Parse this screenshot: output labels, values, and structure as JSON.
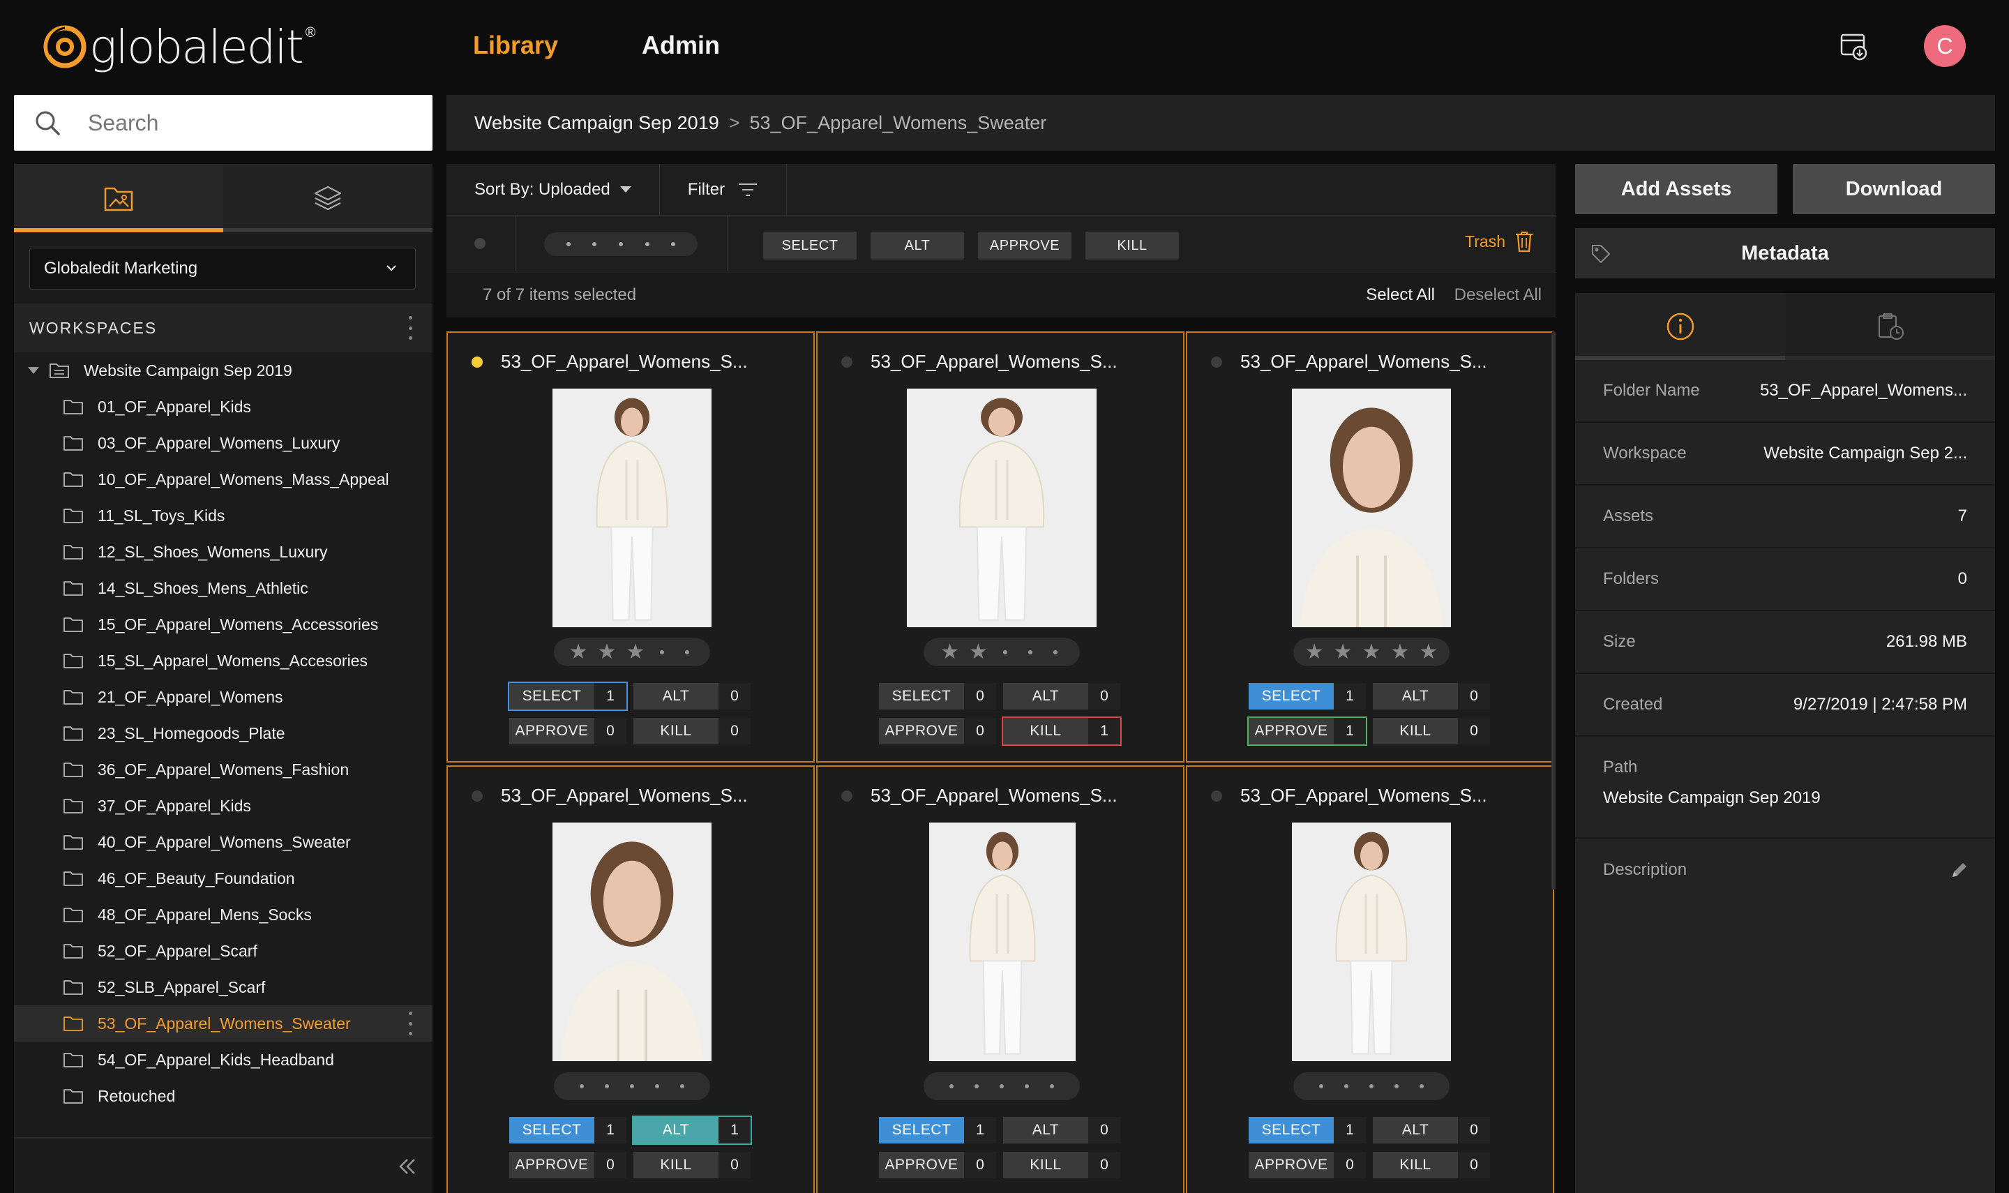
{
  "app": {
    "logo_text": "globaledit",
    "logo_mark": "®"
  },
  "nav": {
    "library": "Library",
    "admin": "Admin",
    "avatar_initial": "C"
  },
  "search": {
    "placeholder": "Search"
  },
  "sidebar": {
    "workspace_select": "Globaledit Marketing",
    "workspaces_title": "WORKSPACES",
    "root": "Website Campaign Sep 2019",
    "folders": [
      "01_OF_Apparel_Kids",
      "03_OF_Apparel_Womens_Luxury",
      "10_OF_Apparel_Womens_Mass_Appeal",
      "11_SL_Toys_Kids",
      "12_SL_Shoes_Womens_Luxury",
      "14_SL_Shoes_Mens_Athletic",
      "15_OF_Apparel_Womens_Accessories",
      "15_SL_Apparel_Womens_Accesories",
      "21_OF_Apparel_Womens",
      "23_SL_Homegoods_Plate",
      "36_OF_Apparel_Womens_Fashion",
      "37_OF_Apparel_Kids",
      "40_OF_Apparel_Womens_Sweater",
      "46_OF_Beauty_Foundation",
      "48_OF_Apparel_Mens_Socks",
      "52_OF_Apparel_Scarf",
      "52_SLB_Apparel_Scarf",
      "53_OF_Apparel_Womens_Sweater",
      "54_OF_Apparel_Kids_Headband",
      "Retouched"
    ],
    "selected_folder_index": 17
  },
  "breadcrumb": {
    "workspace": "Website Campaign Sep 2019",
    "separator": ">",
    "folder": "53_OF_Apparel_Womens_Sweater"
  },
  "toolbar": {
    "sort_label": "Sort By: Uploaded",
    "filter_label": "Filter",
    "select": "SELECT",
    "alt": "ALT",
    "approve": "APPROVE",
    "kill": "KILL",
    "trash": "Trash",
    "selection_count": "7 of 7 items selected",
    "select_all": "Select All",
    "deselect_all": "Deselect All"
  },
  "cards": [
    {
      "title": "53_OF_Apparel_Womens_S...",
      "stars": 3,
      "select": "1",
      "alt": "0",
      "approve": "0",
      "kill": "0"
    },
    {
      "title": "53_OF_Apparel_Womens_S...",
      "stars": 2,
      "select": "0",
      "alt": "0",
      "approve": "0",
      "kill": "1"
    },
    {
      "title": "53_OF_Apparel_Womens_S...",
      "stars": 5,
      "select": "1",
      "alt": "0",
      "approve": "1",
      "kill": "0"
    },
    {
      "title": "53_OF_Apparel_Womens_S...",
      "stars": 0,
      "select": "1",
      "alt": "1",
      "approve": "0",
      "kill": "0"
    },
    {
      "title": "53_OF_Apparel_Womens_S...",
      "stars": 0,
      "select": "1",
      "alt": "0",
      "approve": "0",
      "kill": "0"
    },
    {
      "title": "53_OF_Apparel_Womens_S...",
      "stars": 0,
      "select": "1",
      "alt": "0",
      "approve": "0",
      "kill": "0"
    }
  ],
  "vote_labels": {
    "select": "SELECT",
    "alt": "ALT",
    "approve": "APPROVE",
    "kill": "KILL"
  },
  "right": {
    "add_assets": "Add Assets",
    "download": "Download",
    "metadata_title": "Metadata",
    "rows": [
      {
        "key": "Folder Name",
        "value": "53_OF_Apparel_Womens..."
      },
      {
        "key": "Workspace",
        "value": "Website Campaign Sep 2..."
      },
      {
        "key": "Assets",
        "value": "7"
      },
      {
        "key": "Folders",
        "value": "0"
      },
      {
        "key": "Size",
        "value": "261.98 MB"
      },
      {
        "key": "Created",
        "value": "9/27/2019 | 2:47:58 PM"
      }
    ],
    "path_label": "Path",
    "path_value": "Website Campaign Sep 2019",
    "description_label": "Description"
  },
  "colors": {
    "accent": "#f39c2b",
    "select_blue": "#3e8fd6",
    "kill_red": "#e04545",
    "approve_green": "#4fb35a",
    "alt_teal": "#4aa6a8",
    "avatar": "#ee6b7d"
  }
}
